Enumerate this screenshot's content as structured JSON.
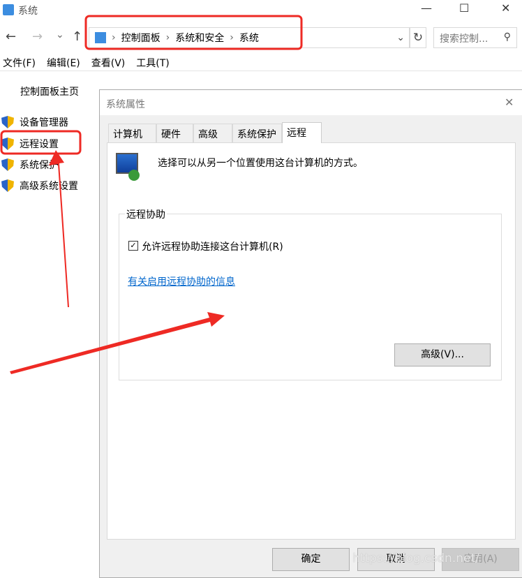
{
  "window": {
    "title": "系统",
    "minimize": "—",
    "maximize": "☐",
    "close": "✕"
  },
  "nav": {
    "back": "←",
    "forward": "→",
    "recent": "⌄",
    "up": "↑",
    "breadcrumb": [
      "控制面板",
      "系统和安全",
      "系统"
    ],
    "separator": "›",
    "dropdown": "⌄",
    "refresh": "↻",
    "search_placeholder": "搜索控制...",
    "search_icon": "⚲"
  },
  "menu": [
    "文件(F)",
    "编辑(E)",
    "查看(V)",
    "工具(T)"
  ],
  "sidebar": {
    "home": "控制面板主页",
    "items": [
      "设备管理器",
      "远程设置",
      "系统保护",
      "高级系统设置"
    ]
  },
  "dialog": {
    "title": "系统属性",
    "close": "✕",
    "tabs": [
      "计算机名",
      "硬件",
      "高级",
      "系统保护",
      "远程"
    ],
    "active_tab": 4,
    "description": "选择可以从另一个位置使用这台计算机的方式。",
    "group": {
      "title": "远程协助",
      "checkbox_label": "允许远程协助连接这台计算机(R)",
      "checked": true,
      "link": "有关启用远程协助的信息",
      "advanced_button": "高级(V)..."
    },
    "buttons": {
      "ok": "确定",
      "cancel": "取消",
      "apply": "应用(A)"
    }
  },
  "watermark": "https://blog.csdn.net/",
  "colors": {
    "annotation": "#ee2a24",
    "link": "#0066cc"
  }
}
